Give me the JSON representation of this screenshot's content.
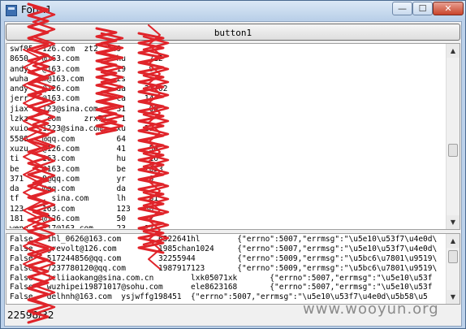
{
  "window": {
    "title": "Form1",
    "minimize_glyph": "—",
    "maximize_glyph": "☐",
    "close_glyph": "✕"
  },
  "toolbar": {
    "button_label": "button1"
  },
  "scrollbar": {
    "up_glyph": "▲",
    "down_glyph": "▼"
  },
  "accounts_list": [
    "swf85  126.com  zt2  549",
    "8650   @163.com        hu     712",
    "andy   @163.com        19     9",
    "wuha   m@163.com       zs",
    "andy   @126.com        da    21102",
    "jerr   @163.com        ca    14",
    "jiax   123@sina.com    31     00",
    "lzkz   .com     zrx77   1",
    "xuio   1223@sina.com   xu    23",
    "5588   @qq.com         64",
    "xuzu   @126.com        41     56",
    "ti     163.com         hu     16",
    "be     @163.com        be    2653",
    "371    8@qq.com        yr     0",
    "da     @qq.com         da",
    "tf     . sina.com      lh     81",
    "123    163.com         123   80",
    "181    @126.com        50     2",
    "weng   317@163.com     23    17"
  ],
  "results_list": [
    "False   1hl_0626@163.com        6522641hl        {\"errno\":5007,\"errmsg\":\"\\u5e10\\u53f7\\u4e0d\\",
    "False   grevolt@126.com         1985chan1024     {\"errno\":5007,\"errmsg\":\"\\u5e10\\u53f7\\u4e0d\\",
    "False   517244856@qq.com        32255944         {\"errno\":5009,\"errmsg\":\"\\u5bc6\\u7801\\u9519\\",
    "False   7237780120@qq.com       1987917123       {\"errno\":5009,\"errmsg\":\"\\u5bc6\\u7801\\u9519\\",
    "False   1cliiaokang@sina.com.cn        lxk05071xk       {\"errno\":5007,\"errmsg\":\"\\u5e10\\u53f",
    "False   wuzhipei19871017@sohu.com      ele8623168       {\"errno\":5007,\"errmsg\":\"\\u5e10\\u53f",
    "False   delhnh@163.com  ysjwffg198451  {\"errno\":5007,\"errmsg\":\"\\u5e10\\u53f7\\u4e0d\\u5b58\\u5"
  ],
  "status": {
    "text": "22598/32"
  },
  "watermark": {
    "text": "www.wooyun.org"
  },
  "colors": {
    "scribble": "#e0242a",
    "title_bar": "#c8daee",
    "close_button": "#c9442a"
  }
}
